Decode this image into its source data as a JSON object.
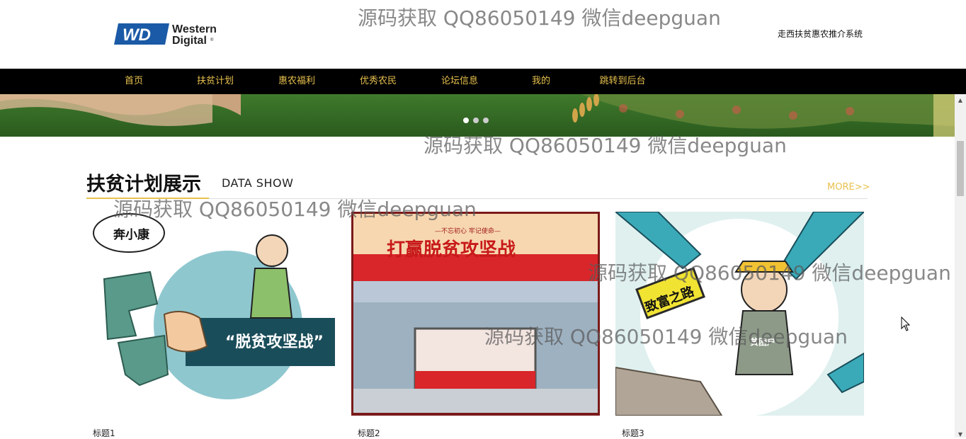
{
  "header": {
    "logo_text": "Western Digital",
    "site_title": "走西扶贫惠农推介系统"
  },
  "nav": {
    "items": [
      {
        "label": "首页"
      },
      {
        "label": "扶贫计划"
      },
      {
        "label": "惠农福利"
      },
      {
        "label": "优秀农民"
      },
      {
        "label": "论坛信息"
      },
      {
        "label": "我的"
      },
      {
        "label": "跳转到后台"
      }
    ]
  },
  "banner": {
    "slide_count": 3,
    "active_slide": 1
  },
  "section": {
    "title": "扶贫计划展示",
    "subtitle": "DATA SHOW",
    "more": "MORE>>"
  },
  "cards": [
    {
      "title": "标题1",
      "image_text": "“脱贫攻坚战”",
      "bubble_text": "奔小康"
    },
    {
      "title": "标题2",
      "image_text": "打赢脱贫攻坚战",
      "image_sub": "—不忘初心 牢记使命—"
    },
    {
      "title": "标题3",
      "image_text": "致富之路",
      "badge_text": "贫困户"
    }
  ],
  "watermark": "源码获取 QQ86050149 微信deepguan"
}
